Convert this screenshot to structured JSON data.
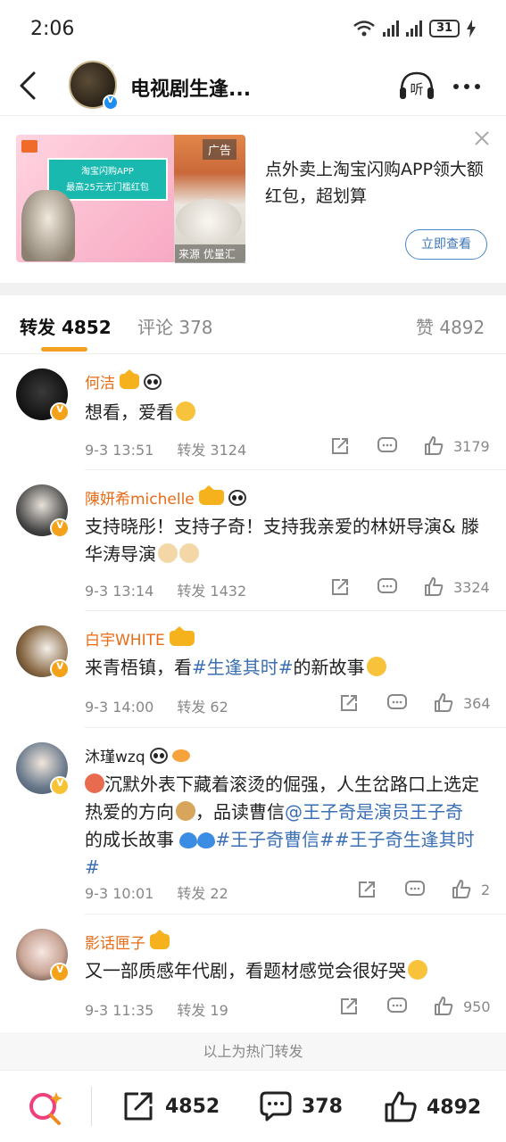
{
  "status": {
    "time": "2:06",
    "battery": "31"
  },
  "header": {
    "title": "电视剧生逢...",
    "listen_label": "听"
  },
  "ad": {
    "banner_line1": "淘宝闪购APP",
    "banner_line2": "最高25元无门槛红包",
    "tag": "广告",
    "source": "来源 优量汇",
    "text": "点外卖上淘宝闪购APP领大额红包，超划算",
    "cta": "立即查看"
  },
  "tabs": {
    "reposts": "转发 4852",
    "comments": "评论 378",
    "likes": "赞 4892"
  },
  "comments": [
    {
      "name": "何洁",
      "text": "想看，爱看",
      "date": "9-3 13:51",
      "reposts": "转发 3124",
      "likes": "3179"
    },
    {
      "name": "陳妍希michelle",
      "text": "支持晓彤！支持子奇！支持我亲爱的林妍导演& 滕华涛导演",
      "date": "9-3 13:14",
      "reposts": "转发 1432",
      "likes": "3324"
    },
    {
      "name": "白宇WHITE",
      "text_a": "来青梧镇，看",
      "tag": "#生逢其时#",
      "text_b": "的新故事",
      "date": "9-3 14:00",
      "reposts": "转发 62",
      "likes": "364"
    },
    {
      "name": "沐瑾wzq",
      "text_a": "沉默外表下藏着滚烫的倔强，人生岔路口上选定热爱的方向",
      "text_b": "，品读曹信",
      "mention": "@王子奇是演员王子奇",
      "text_c": " 的成长故事 ",
      "tag1": "#王子奇曹信#",
      "tag2": "#王子奇生逢其时#",
      "date": "9-3 10:01",
      "reposts": "转发 22",
      "likes": "2"
    },
    {
      "name": "影话匣子",
      "text": "又一部质感年代剧，看题材感觉会很好哭",
      "date": "9-3 11:35",
      "reposts": "转发 19",
      "likes": "950"
    }
  ],
  "footer_hint": "以上为热门转发",
  "bottom_bar": {
    "reposts": "4852",
    "comments": "378",
    "likes": "4892"
  },
  "colors": {
    "accent": "#f4a020",
    "link": "#3b6fb6",
    "orange_name": "#e86b16"
  }
}
